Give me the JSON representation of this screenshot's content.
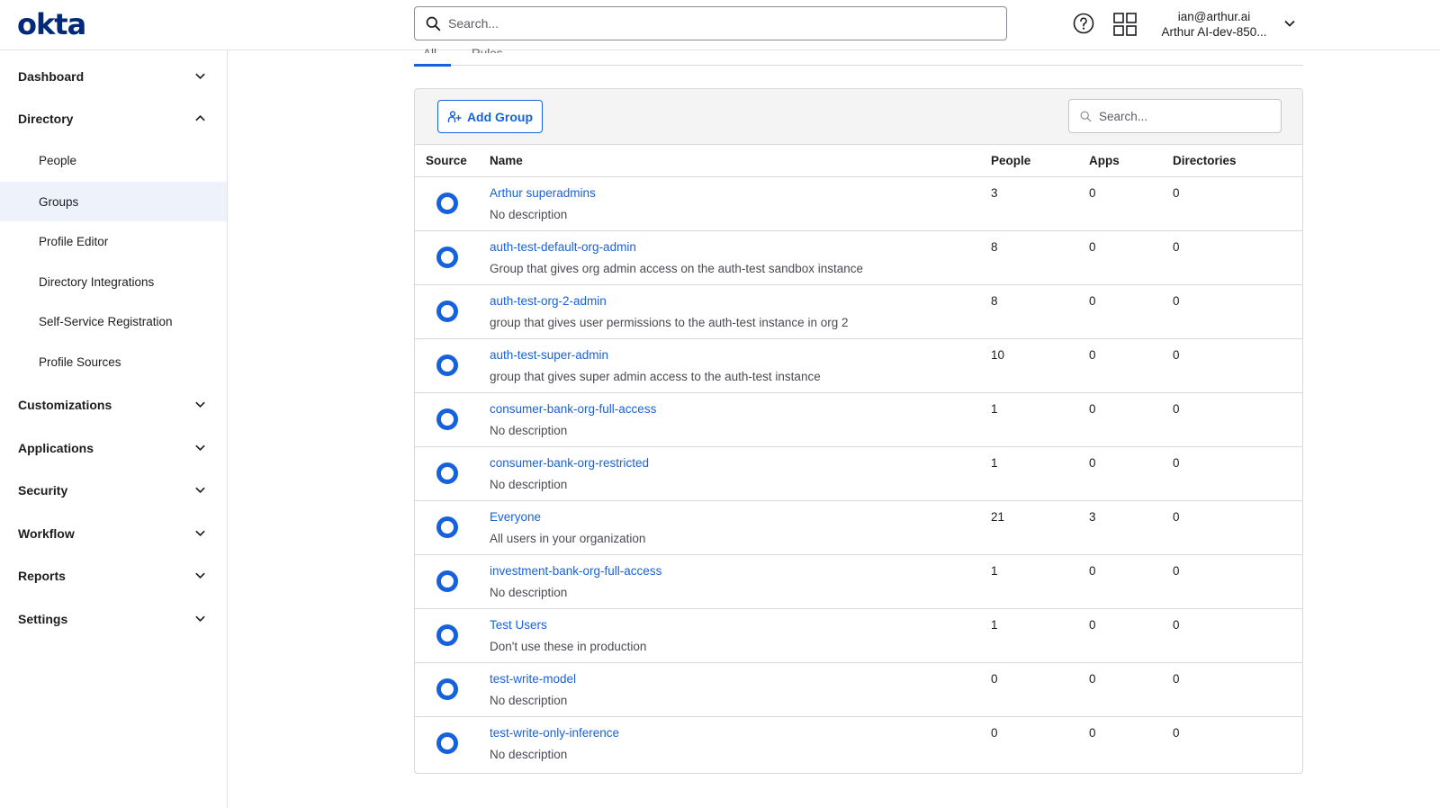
{
  "header": {
    "logo": "okta",
    "search_placeholder": "Search...",
    "user_email": "ian@arthur.ai",
    "user_org": "Arthur AI-dev-850..."
  },
  "sidebar": {
    "items": [
      {
        "label": "Dashboard"
      },
      {
        "label": "Directory"
      },
      {
        "label": "Customizations"
      },
      {
        "label": "Applications"
      },
      {
        "label": "Security"
      },
      {
        "label": "Workflow"
      },
      {
        "label": "Reports"
      },
      {
        "label": "Settings"
      }
    ],
    "directory_sub": [
      {
        "label": "People"
      },
      {
        "label": "Groups"
      },
      {
        "label": "Profile Editor"
      },
      {
        "label": "Directory Integrations"
      },
      {
        "label": "Self-Service Registration"
      },
      {
        "label": "Profile Sources"
      }
    ]
  },
  "tabs": {
    "all": "All",
    "rules": "Rules"
  },
  "toolbar": {
    "add_group_label": "Add Group",
    "search_placeholder": "Search..."
  },
  "table": {
    "columns": [
      "Source",
      "Name",
      "People",
      "Apps",
      "Directories"
    ],
    "rows": [
      {
        "name": "Arthur superadmins",
        "description": "No description",
        "people": "3",
        "apps": "0",
        "directories": "0"
      },
      {
        "name": "auth-test-default-org-admin",
        "description": "Group that gives org admin access on the auth-test sandbox instance",
        "people": "8",
        "apps": "0",
        "directories": "0"
      },
      {
        "name": "auth-test-org-2-admin",
        "description": "group that gives user permissions to the auth-test instance in org 2",
        "people": "8",
        "apps": "0",
        "directories": "0"
      },
      {
        "name": "auth-test-super-admin",
        "description": "group that gives super admin access to the auth-test instance",
        "people": "10",
        "apps": "0",
        "directories": "0"
      },
      {
        "name": "consumer-bank-org-full-access",
        "description": "No description",
        "people": "1",
        "apps": "0",
        "directories": "0"
      },
      {
        "name": "consumer-bank-org-restricted",
        "description": "No description",
        "people": "1",
        "apps": "0",
        "directories": "0"
      },
      {
        "name": "Everyone",
        "description": "All users in your organization",
        "people": "21",
        "apps": "3",
        "directories": "0"
      },
      {
        "name": "investment-bank-org-full-access",
        "description": "No description",
        "people": "1",
        "apps": "0",
        "directories": "0"
      },
      {
        "name": "Test Users",
        "description": "Don't use these in production",
        "people": "1",
        "apps": "0",
        "directories": "0"
      },
      {
        "name": "test-write-model",
        "description": "No description",
        "people": "0",
        "apps": "0",
        "directories": "0"
      },
      {
        "name": "test-write-only-inference",
        "description": "No description",
        "people": "0",
        "apps": "0",
        "directories": "0"
      }
    ]
  },
  "colors": {
    "accent": "#1662dd",
    "brand": "#00297a",
    "active_nav_bg": "#eef2fb"
  }
}
